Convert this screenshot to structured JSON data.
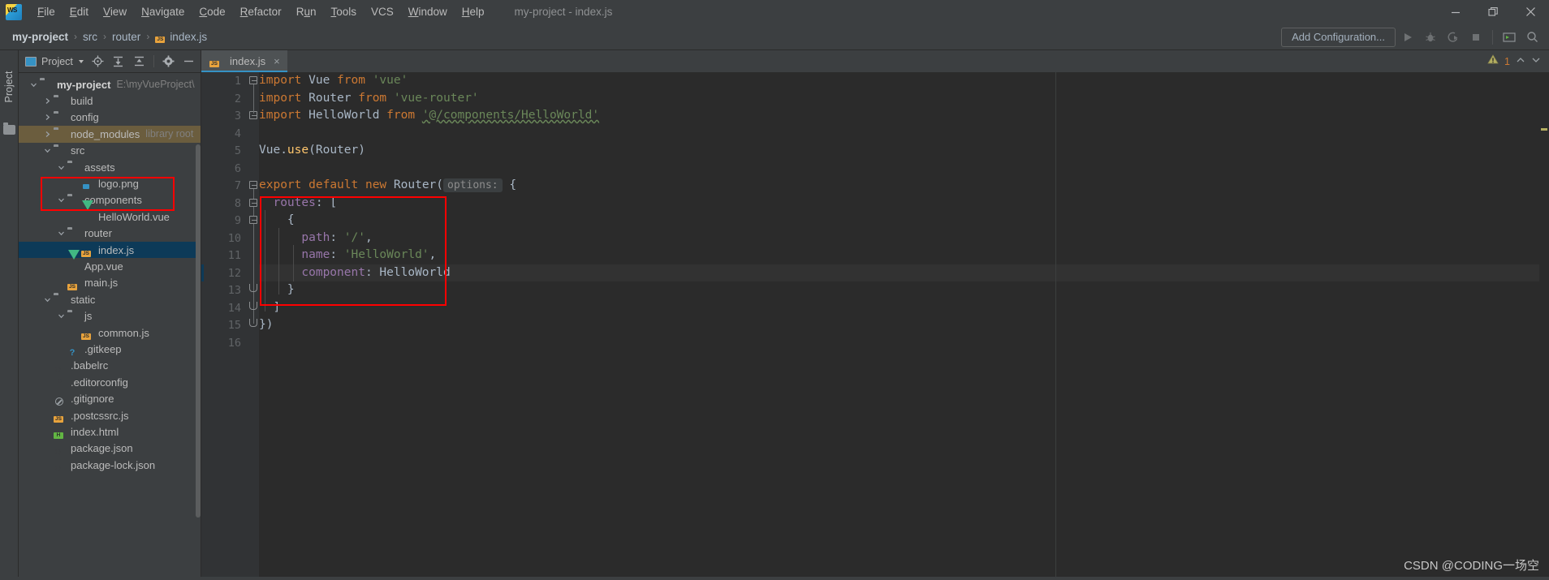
{
  "window": {
    "title": "my-project - index.js",
    "controls": {
      "minimize": "minimize-icon",
      "maximize": "restore-icon",
      "close": "close-icon"
    }
  },
  "menu": {
    "items": [
      {
        "label": "File",
        "mnemonic": "F"
      },
      {
        "label": "Edit",
        "mnemonic": "E"
      },
      {
        "label": "View",
        "mnemonic": "V"
      },
      {
        "label": "Navigate",
        "mnemonic": "N"
      },
      {
        "label": "Code",
        "mnemonic": "C"
      },
      {
        "label": "Refactor",
        "mnemonic": "R"
      },
      {
        "label": "Run",
        "mnemonic": "u"
      },
      {
        "label": "Tools",
        "mnemonic": "T"
      },
      {
        "label": "VCS",
        "mnemonic": ""
      },
      {
        "label": "Window",
        "mnemonic": "W"
      },
      {
        "label": "Help",
        "mnemonic": "H"
      }
    ]
  },
  "breadcrumb": {
    "separator": "›",
    "items": [
      {
        "label": "my-project",
        "bold": true,
        "icon": ""
      },
      {
        "label": "src",
        "bold": false,
        "icon": ""
      },
      {
        "label": "router",
        "bold": false,
        "icon": ""
      },
      {
        "label": "index.js",
        "bold": false,
        "icon": "js-file-icon"
      }
    ]
  },
  "toolbar": {
    "add_configuration": "Add Configuration...",
    "icons": [
      "run-icon",
      "debug-icon",
      "run-coverage-icon",
      "stop-icon",
      "separator",
      "terminal-icon",
      "search-everywhere-icon"
    ]
  },
  "toolstrip": {
    "label": "Project",
    "icon": "project-folder-icon"
  },
  "project_panel": {
    "title": "Project",
    "title_icon": "project-view-icon",
    "buttons": [
      "locate-icon",
      "expand-all-icon",
      "collapse-all-icon",
      "settings-gear-icon",
      "hide-icon"
    ],
    "tree": [
      {
        "depth": 0,
        "label": "my-project",
        "note": "E:\\myVueProject\\",
        "icon": "folder",
        "twisty": "open",
        "bold": true,
        "state": "normal"
      },
      {
        "depth": 1,
        "label": "build",
        "note": "",
        "icon": "folder",
        "twisty": "closed",
        "bold": false,
        "state": "normal"
      },
      {
        "depth": 1,
        "label": "config",
        "note": "",
        "icon": "folder",
        "twisty": "closed",
        "bold": false,
        "state": "normal"
      },
      {
        "depth": 1,
        "label": "node_modules",
        "note": "library root",
        "icon": "folder",
        "twisty": "closed",
        "bold": false,
        "state": "library"
      },
      {
        "depth": 1,
        "label": "src",
        "note": "",
        "icon": "folder",
        "twisty": "open",
        "bold": false,
        "state": "normal"
      },
      {
        "depth": 2,
        "label": "assets",
        "note": "",
        "icon": "folder",
        "twisty": "open",
        "bold": false,
        "state": "normal"
      },
      {
        "depth": 3,
        "label": "logo.png",
        "note": "",
        "icon": "image",
        "twisty": "none",
        "bold": false,
        "state": "normal"
      },
      {
        "depth": 2,
        "label": "components",
        "note": "",
        "icon": "folder",
        "twisty": "open",
        "bold": false,
        "state": "normal"
      },
      {
        "depth": 3,
        "label": "HelloWorld.vue",
        "note": "",
        "icon": "vue",
        "twisty": "none",
        "bold": false,
        "state": "normal"
      },
      {
        "depth": 2,
        "label": "router",
        "note": "",
        "icon": "folder",
        "twisty": "open",
        "bold": false,
        "state": "normal"
      },
      {
        "depth": 3,
        "label": "index.js",
        "note": "",
        "icon": "js",
        "twisty": "none",
        "bold": false,
        "state": "selected"
      },
      {
        "depth": 2,
        "label": "App.vue",
        "note": "",
        "icon": "vue",
        "twisty": "none",
        "bold": false,
        "state": "normal"
      },
      {
        "depth": 2,
        "label": "main.js",
        "note": "",
        "icon": "js",
        "twisty": "none",
        "bold": false,
        "state": "normal"
      },
      {
        "depth": 1,
        "label": "static",
        "note": "",
        "icon": "folder",
        "twisty": "open",
        "bold": false,
        "state": "normal"
      },
      {
        "depth": 2,
        "label": "js",
        "note": "",
        "icon": "folder",
        "twisty": "open",
        "bold": false,
        "state": "normal"
      },
      {
        "depth": 3,
        "label": "common.js",
        "note": "",
        "icon": "js",
        "twisty": "none",
        "bold": false,
        "state": "normal"
      },
      {
        "depth": 2,
        "label": ".gitkeep",
        "note": "",
        "icon": "unknown",
        "twisty": "none",
        "bold": false,
        "state": "normal"
      },
      {
        "depth": 1,
        "label": ".babelrc",
        "note": "",
        "icon": "json",
        "twisty": "none",
        "bold": false,
        "state": "normal"
      },
      {
        "depth": 1,
        "label": ".editorconfig",
        "note": "",
        "icon": "gear",
        "twisty": "none",
        "bold": false,
        "state": "normal"
      },
      {
        "depth": 1,
        "label": ".gitignore",
        "note": "",
        "icon": "gitignore",
        "twisty": "none",
        "bold": false,
        "state": "normal"
      },
      {
        "depth": 1,
        "label": ".postcssrc.js",
        "note": "",
        "icon": "js",
        "twisty": "none",
        "bold": false,
        "state": "normal"
      },
      {
        "depth": 1,
        "label": "index.html",
        "note": "",
        "icon": "html",
        "twisty": "none",
        "bold": false,
        "state": "normal"
      },
      {
        "depth": 1,
        "label": "package.json",
        "note": "",
        "icon": "json",
        "twisty": "none",
        "bold": false,
        "state": "normal"
      },
      {
        "depth": 1,
        "label": "package-lock.json",
        "note": "",
        "icon": "json",
        "twisty": "none",
        "bold": false,
        "state": "normal"
      }
    ]
  },
  "editor": {
    "tab": {
      "label": "index.js",
      "icon": "js-file-icon",
      "close": "×"
    },
    "inspection": {
      "warning_icon": "warning-triangle-icon",
      "count": "1",
      "prev": "∧",
      "next": "∨"
    },
    "line_numbers": [
      "1",
      "2",
      "3",
      "4",
      "5",
      "6",
      "7",
      "8",
      "9",
      "10",
      "11",
      "12",
      "13",
      "14",
      "15",
      "16"
    ],
    "code_lines": [
      {
        "n": 1,
        "tokens": [
          {
            "t": "import",
            "c": "kw"
          },
          {
            "t": " Vue ",
            "c": "plain"
          },
          {
            "t": "from",
            "c": "kw"
          },
          {
            "t": " ",
            "c": "plain"
          },
          {
            "t": "'vue'",
            "c": "str"
          }
        ]
      },
      {
        "n": 2,
        "tokens": [
          {
            "t": "import",
            "c": "kw"
          },
          {
            "t": " Router ",
            "c": "plain"
          },
          {
            "t": "from",
            "c": "kw"
          },
          {
            "t": " ",
            "c": "plain"
          },
          {
            "t": "'vue-router'",
            "c": "str"
          }
        ]
      },
      {
        "n": 3,
        "tokens": [
          {
            "t": "import",
            "c": "kw"
          },
          {
            "t": " HelloWorld ",
            "c": "plain"
          },
          {
            "t": "from",
            "c": "kw"
          },
          {
            "t": " ",
            "c": "plain"
          },
          {
            "t": "'@/components/HelloWorld'",
            "c": "strlink"
          }
        ]
      },
      {
        "n": 4,
        "tokens": []
      },
      {
        "n": 5,
        "tokens": [
          {
            "t": "Vue.",
            "c": "plain"
          },
          {
            "t": "use",
            "c": "fn"
          },
          {
            "t": "(Router)",
            "c": "plain"
          }
        ]
      },
      {
        "n": 6,
        "tokens": []
      },
      {
        "n": 7,
        "tokens": [
          {
            "t": "export",
            "c": "kw"
          },
          {
            "t": " ",
            "c": "plain"
          },
          {
            "t": "default",
            "c": "kw"
          },
          {
            "t": " ",
            "c": "plain"
          },
          {
            "t": "new",
            "c": "kw"
          },
          {
            "t": " Router(",
            "c": "plain"
          },
          {
            "t": "options:",
            "c": "hint"
          },
          {
            "t": " {",
            "c": "plain"
          }
        ]
      },
      {
        "n": 8,
        "tokens": [
          {
            "t": "  ",
            "c": "plain"
          },
          {
            "t": "routes",
            "c": "prop"
          },
          {
            "t": ": [",
            "c": "plain"
          }
        ]
      },
      {
        "n": 9,
        "tokens": [
          {
            "t": "    {",
            "c": "plain"
          }
        ]
      },
      {
        "n": 10,
        "tokens": [
          {
            "t": "      ",
            "c": "plain"
          },
          {
            "t": "path",
            "c": "prop"
          },
          {
            "t": ": ",
            "c": "plain"
          },
          {
            "t": "'/'",
            "c": "str"
          },
          {
            "t": ",",
            "c": "plain"
          }
        ]
      },
      {
        "n": 11,
        "tokens": [
          {
            "t": "      ",
            "c": "plain"
          },
          {
            "t": "name",
            "c": "prop"
          },
          {
            "t": ": ",
            "c": "plain"
          },
          {
            "t": "'HelloWorld'",
            "c": "str"
          },
          {
            "t": ",",
            "c": "plain"
          }
        ]
      },
      {
        "n": 12,
        "tokens": [
          {
            "t": "      ",
            "c": "plain"
          },
          {
            "t": "component",
            "c": "prop"
          },
          {
            "t": ": HelloWorld",
            "c": "plain"
          }
        ]
      },
      {
        "n": 13,
        "tokens": [
          {
            "t": "    }",
            "c": "plain"
          }
        ]
      },
      {
        "n": 14,
        "tokens": [
          {
            "t": "  ]",
            "c": "plain"
          }
        ]
      },
      {
        "n": 15,
        "tokens": [
          {
            "t": "})",
            "c": "plain"
          }
        ]
      },
      {
        "n": 16,
        "tokens": []
      }
    ]
  },
  "annotations": {
    "highlight_color": "#ff0000",
    "boxes": [
      {
        "name": "router-folder-highlight",
        "target": "router / index.js tree rows"
      },
      {
        "name": "routes-code-highlight",
        "target": "routes array code block lines 8-14"
      }
    ]
  },
  "watermark": "CSDN @CODING一场空"
}
